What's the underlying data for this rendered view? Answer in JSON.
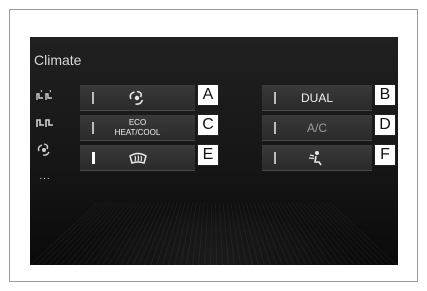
{
  "screen": {
    "title": "Climate",
    "side_icons": [
      "seat-heater-icon",
      "seat-ventilation-icon",
      "fan-icon",
      "more-icon"
    ],
    "more_label": "..."
  },
  "buttons": [
    {
      "id": "fan",
      "label": "",
      "icon": "fan-icon",
      "tag": "A",
      "indicator": "off"
    },
    {
      "id": "dual",
      "label": "DUAL",
      "icon": "",
      "tag": "B",
      "indicator": "off"
    },
    {
      "id": "eco",
      "label_line1": "ECO",
      "label_line2": "HEAT/COOL",
      "tag": "C",
      "indicator": "off"
    },
    {
      "id": "ac",
      "label": "A/C",
      "tag": "D",
      "indicator": "off",
      "dimmed": true
    },
    {
      "id": "defrost",
      "label": "",
      "icon": "windshield-defrost-icon",
      "tag": "E",
      "indicator": "on"
    },
    {
      "id": "airflow",
      "label": "",
      "icon": "airflow-mode-icon",
      "tag": "F",
      "indicator": "off"
    }
  ],
  "colors": {
    "screen_bg": "#1a1a1a",
    "button_bg": "#333333",
    "text": "#f0f0f0",
    "indicator_on": "#ffffff"
  }
}
